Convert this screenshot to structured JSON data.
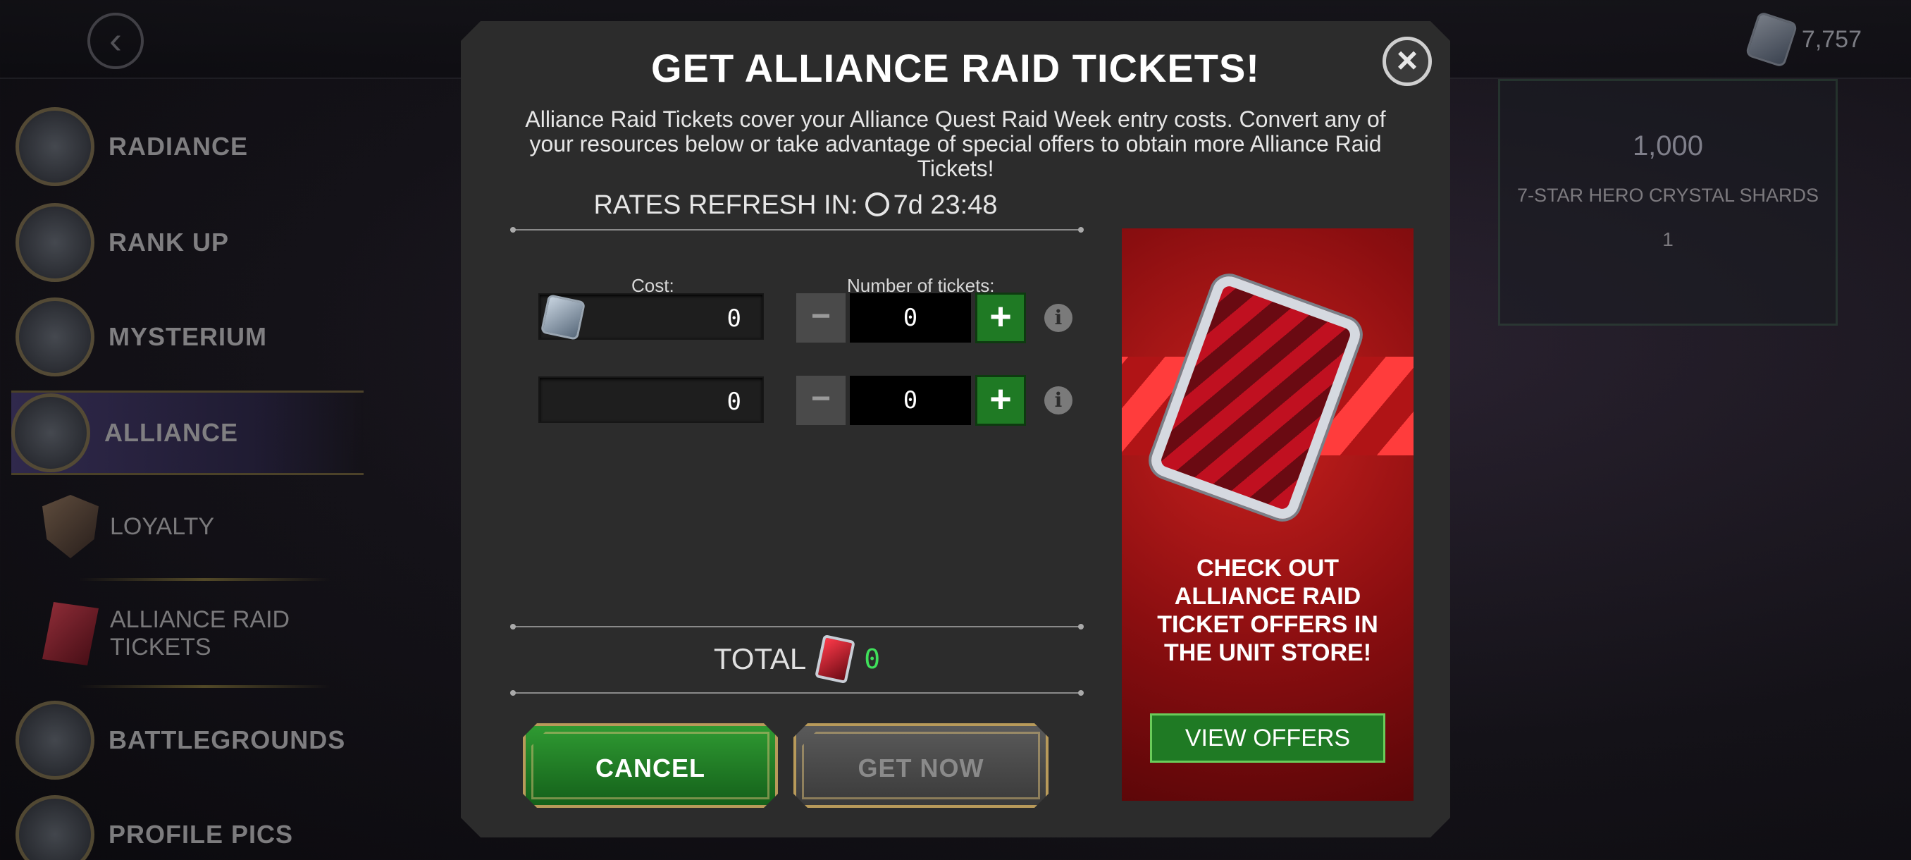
{
  "background": {
    "currency_value": "7,757",
    "sidebar": [
      {
        "label": "RADIANCE"
      },
      {
        "label": "RANK UP"
      },
      {
        "label": "MYSTERIUM"
      },
      {
        "label": "ALLIANCE"
      },
      {
        "label": "BATTLEGROUNDS"
      },
      {
        "label": "PROFILE PICS"
      }
    ],
    "sidebar_sub": [
      {
        "label": "LOYALTY"
      },
      {
        "label": "ALLIANCE RAID TICKETS"
      }
    ],
    "store_card": {
      "amount": "1,000",
      "name": "7-STAR HERO CRYSTAL SHARDS",
      "cost": "1"
    }
  },
  "modal": {
    "title": "GET ALLIANCE RAID TICKETS!",
    "description": "Alliance Raid Tickets cover your Alliance Quest Raid Week entry costs. Convert any of your resources below or take advantage of special offers to obtain more Alliance Raid Tickets!",
    "refresh_label": "RATES REFRESH IN:",
    "refresh_time": "7d 23:48",
    "cost_label": "Cost:",
    "tickets_label": "Number of tickets:",
    "rows": [
      {
        "cost": "0",
        "count": "0"
      },
      {
        "cost": "0",
        "count": "0"
      }
    ],
    "minus_symbol": "−",
    "plus_symbol": "+",
    "info_symbol": "i",
    "total_label": "TOTAL",
    "total_value": "0",
    "cancel_label": "CANCEL",
    "get_now_label": "GET NOW",
    "close_symbol": "×",
    "promo": {
      "text": "CHECK OUT ALLIANCE RAID TICKET OFFERS IN THE UNIT STORE!",
      "button_label": "VIEW OFFERS"
    }
  }
}
